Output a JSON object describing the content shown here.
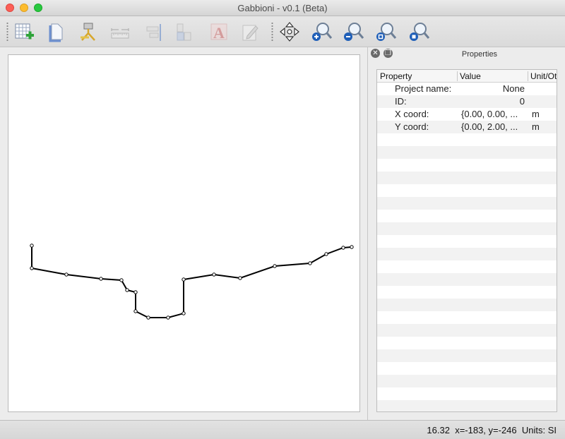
{
  "window": {
    "title": "Gabbioni - v0.1 (Beta)"
  },
  "toolbar": {
    "tools": [
      {
        "icon": "new-grid-icon",
        "enabled": true
      },
      {
        "icon": "open-file-icon",
        "enabled": true
      },
      {
        "icon": "surveying-level-icon",
        "enabled": true
      },
      {
        "icon": "dimension-ruler-icon",
        "enabled": false
      },
      {
        "icon": "align-right-icon",
        "enabled": false
      },
      {
        "icon": "align-blocks-icon",
        "enabled": false
      },
      {
        "icon": "text-style-icon",
        "enabled": false
      },
      {
        "icon": "edit-pencil-icon",
        "enabled": false
      },
      {
        "icon": "pan-move-icon",
        "enabled": true
      },
      {
        "icon": "zoom-in-icon",
        "enabled": true
      },
      {
        "icon": "zoom-out-icon",
        "enabled": true
      },
      {
        "icon": "zoom-fit-icon",
        "enabled": true
      },
      {
        "icon": "zoom-reset-icon",
        "enabled": true
      }
    ]
  },
  "profile": {
    "points": [
      [
        33,
        270
      ],
      [
        33,
        302
      ],
      [
        82,
        311
      ],
      [
        131,
        317
      ],
      [
        160,
        319
      ],
      [
        168,
        333
      ],
      [
        180,
        336
      ],
      [
        180,
        363
      ],
      [
        198,
        372
      ],
      [
        226,
        372
      ],
      [
        248,
        366
      ],
      [
        248,
        318
      ],
      [
        291,
        311
      ],
      [
        328,
        316
      ],
      [
        377,
        299
      ],
      [
        427,
        295
      ],
      [
        450,
        282
      ],
      [
        474,
        273
      ],
      [
        486,
        272
      ]
    ]
  },
  "properties": {
    "title": "Properties",
    "headers": {
      "property": "Property",
      "value": "Value",
      "unit": "Unit/Ot"
    },
    "rows": [
      {
        "property": "Project name:",
        "value": "None",
        "unit": "",
        "align": "right"
      },
      {
        "property": "ID:",
        "value": "0",
        "unit": "",
        "align": "right"
      },
      {
        "property": "X coord:",
        "value": "{0.00, 0.00, ...",
        "unit": "m",
        "align": "left"
      },
      {
        "property": "Y coord:",
        "value": "{0.00, 2.00, ...",
        "unit": "m",
        "align": "left"
      }
    ]
  },
  "status": {
    "zoom": "16.32",
    "coords": "x=-183, y=-246",
    "units": "Units: SI"
  }
}
